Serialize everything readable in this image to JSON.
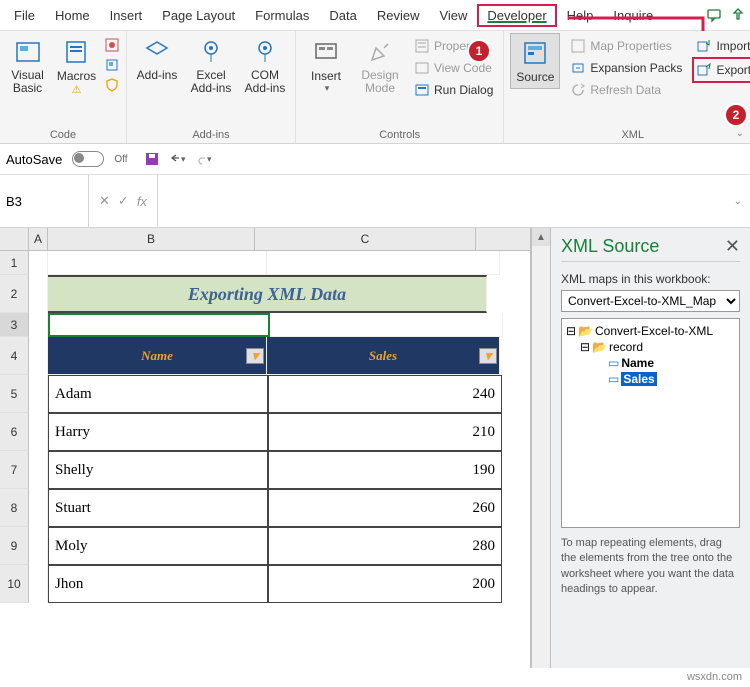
{
  "tabs": [
    "File",
    "Home",
    "Insert",
    "Page Layout",
    "Formulas",
    "Data",
    "Review",
    "View",
    "Developer",
    "Help",
    "Inquire"
  ],
  "active_tab": "Developer",
  "ribbon": {
    "code": {
      "label": "Code",
      "visual_basic": "Visual Basic",
      "macros": "Macros"
    },
    "addins": {
      "label": "Add-ins",
      "addins": "Add-ins",
      "excel": "Excel Add-ins",
      "com": "COM Add-ins"
    },
    "controls": {
      "label": "Controls",
      "insert": "Insert",
      "design": "Design Mode",
      "properties": "Properties",
      "view_code": "View Code",
      "run_dialog": "Run Dialog"
    },
    "xml": {
      "label": "XML",
      "source": "Source",
      "map_props": "Map Properties",
      "expansion": "Expansion Packs",
      "refresh": "Refresh Data",
      "import": "Import",
      "export": "Export"
    }
  },
  "qat": {
    "autosave": "AutoSave",
    "state": "Off"
  },
  "namebox": "B3",
  "fx": "fx",
  "col_headers": [
    "A",
    "B",
    "C"
  ],
  "row_headers": [
    "1",
    "2",
    "3",
    "4",
    "5",
    "6",
    "7",
    "8",
    "9",
    "10"
  ],
  "sheet_title": "Exporting XML Data",
  "table": {
    "headers": [
      "Name",
      "Sales"
    ],
    "rows": [
      {
        "name": "Adam",
        "sales": "240"
      },
      {
        "name": "Harry",
        "sales": "210"
      },
      {
        "name": "Shelly",
        "sales": "190"
      },
      {
        "name": "Stuart",
        "sales": "260"
      },
      {
        "name": "Moly",
        "sales": "280"
      },
      {
        "name": "Jhon",
        "sales": "200"
      }
    ]
  },
  "xml_pane": {
    "title": "XML Source",
    "maps_label": "XML maps in this workbook:",
    "map_selected": "Convert-Excel-to-XML_Map",
    "root": "Convert-Excel-to-XML",
    "record": "record",
    "name": "Name",
    "sales": "Sales",
    "hint": "To map repeating elements, drag the elements from the tree onto the worksheet where you want the data headings to appear."
  },
  "badges": {
    "one": "1",
    "two": "2"
  },
  "watermark": "wsxdn.com"
}
